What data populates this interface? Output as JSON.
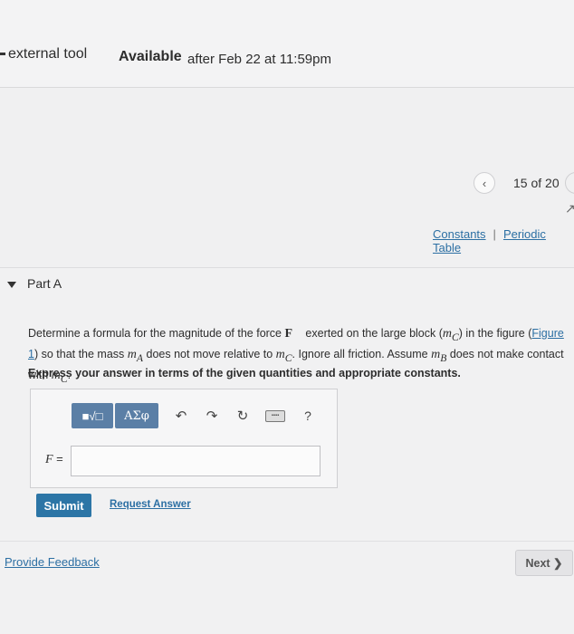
{
  "header": {
    "tool_label": "external tool",
    "available_label": "Available",
    "available_date": "after Feb 22 at 11:59pm"
  },
  "pager": {
    "prev_icon": "chevron-left-icon",
    "count": "15 of 20"
  },
  "links": {
    "constants": "Constants",
    "separator": "|",
    "periodic_table": "Periodic Table"
  },
  "part": {
    "title": "Part A"
  },
  "problem": {
    "t1": "Determine a formula for the magnitude of the force ",
    "force_symbol": "F⃗",
    "t2": " exerted on the large block (",
    "mc": "m",
    "mc_sub": "C",
    "t3": ") in the figure (",
    "figure_link": "Figure 1",
    "t4": ") so that the mass ",
    "ma": "m",
    "ma_sub": "A",
    "t5": " does not move relative to ",
    "mc2": "m",
    "mc2_sub": "C",
    "t6": ". Ignore all friction. Assume ",
    "mb": "m",
    "mb_sub": "B",
    "t7": " does not make contact with ",
    "mc3": "m",
    "mc3_sub": "C",
    "t8": ".",
    "instruction": "Express your answer in terms of the given quantities and appropriate constants."
  },
  "answer": {
    "toolbar": {
      "math_button": "■√□",
      "greek_button": "ΑΣφ",
      "undo_icon": "undo-icon",
      "redo_icon": "redo-icon",
      "reset_icon": "reset-icon",
      "keyboard_icon": "keyboard-icon",
      "help": "?"
    },
    "label_var": "F",
    "label_eq": " =",
    "input_value": ""
  },
  "actions": {
    "submit": "Submit",
    "request_answer": "Request Answer"
  },
  "footer": {
    "feedback": "Provide Feedback",
    "next": "Next ❯"
  }
}
